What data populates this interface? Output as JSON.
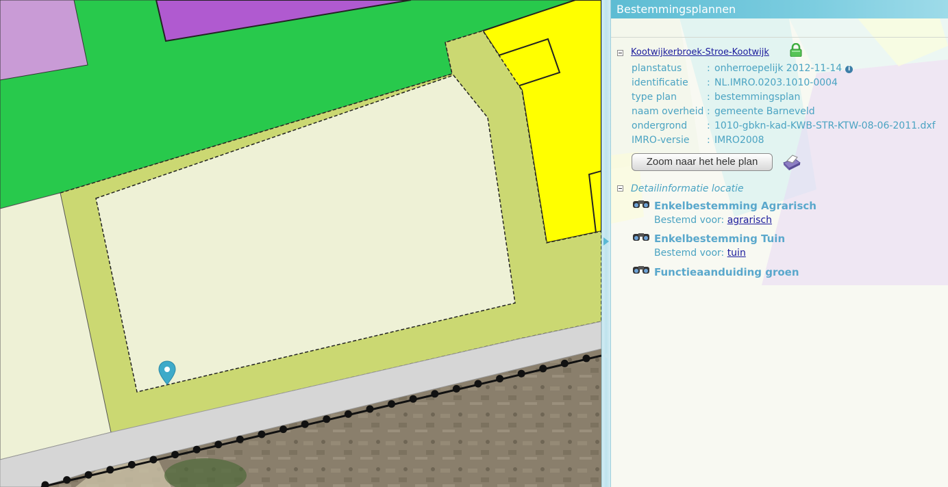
{
  "panel": {
    "title": "Bestemmingsplannen",
    "plan": {
      "name": "Kootwijkerbroek-Stroe-Kootwijk",
      "lock_icon": "lock-icon",
      "properties": [
        {
          "key": "planstatus",
          "value": "onherroepelijk 2012-11-14",
          "info": true
        },
        {
          "key": "identificatie",
          "value": "NL.IMRO.0203.1010-0004"
        },
        {
          "key": "type plan",
          "value": "bestemmingsplan"
        },
        {
          "key": "naam overheid",
          "value": "gemeente Barneveld"
        },
        {
          "key": "ondergrond",
          "value": "1010-gbkn-kad-KWB-STR-KTW-08-06-2011.dxf"
        },
        {
          "key": "IMRO-versie",
          "value": "IMRO2008"
        }
      ],
      "zoom_button": "Zoom naar het hele plan",
      "print_icon": "printer-icon"
    },
    "detail": {
      "title": "Detailinformatie locatie",
      "items": [
        {
          "name": "Enkelbestemming Agrarisch",
          "sub_label": "Bestemd voor:",
          "sub_link": "agrarisch"
        },
        {
          "name": "Enkelbestemming Tuin",
          "sub_label": "Bestemd voor:",
          "sub_link": "tuin"
        },
        {
          "name": "Functieaanduiding groen"
        }
      ]
    },
    "separator": ":"
  },
  "map": {
    "colors": {
      "groen": "#28c94c",
      "maatschappelijk": "#b05ad0",
      "light_purple": "#c99bd6",
      "agrarisch": "#eef1d6",
      "tuin": "#cbd872",
      "wonen": "#ffff00",
      "verkeer": "#d6d6d6",
      "marker": "#3eaac9"
    },
    "marker_icon": "location-pin-icon"
  },
  "colors": {
    "header": "#5dbcd3",
    "text": "#4aa3c2",
    "link": "#1a1a9c"
  }
}
